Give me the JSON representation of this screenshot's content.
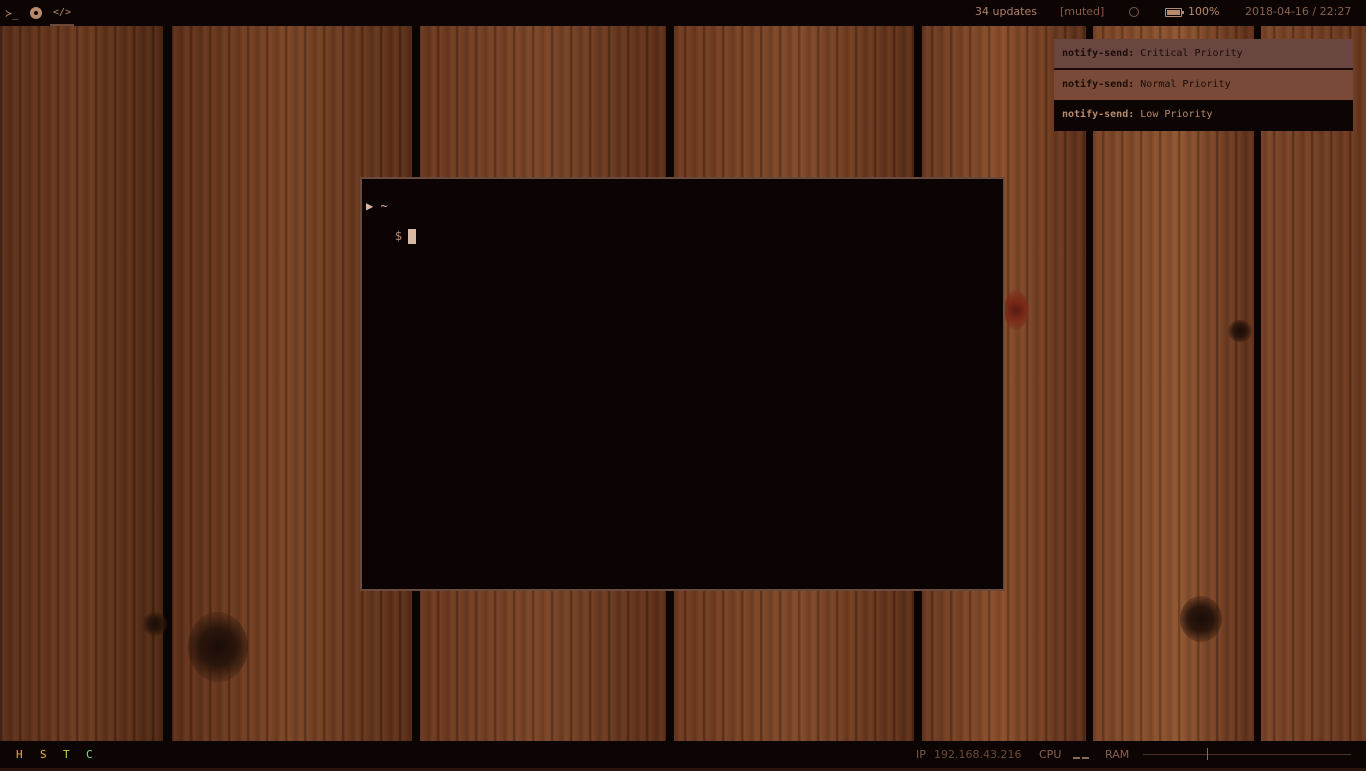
{
  "colors": {
    "bar_bg": "#0d0504",
    "accent": "#b88a6c",
    "terminal_bg": "#0c0404",
    "terminal_border": "#6a4a3a",
    "notif_critical_bg": "#6a4640",
    "notif_normal_bg": "#7a4a38",
    "notif_low_bg": "#0d0504",
    "tag_H": "#f2a33a",
    "tag_S": "#e8b545",
    "tag_T": "#b8d44a",
    "tag_C": "#7fe07a"
  },
  "topbar": {
    "workspaces": [
      {
        "icon": "terminal-icon",
        "glyph": "≻_"
      },
      {
        "icon": "chrome-icon",
        "glyph": ""
      },
      {
        "icon": "code-icon",
        "glyph": "</>"
      }
    ],
    "updates": "34 updates",
    "volume": "[muted]",
    "battery": "100%",
    "datetime": "2018-04-16 / 22:27"
  },
  "notifications": [
    {
      "app": "notify-send:",
      "message": "Critical Priority",
      "level": "critical"
    },
    {
      "app": "notify-send:",
      "message": "Normal Priority",
      "level": "normal"
    },
    {
      "app": "notify-send:",
      "message": "Low Priority",
      "level": "low"
    }
  ],
  "terminal": {
    "prompt_dir": "▶ ~",
    "prompt_symbol": "$"
  },
  "bottombar": {
    "tags": [
      "H",
      "S",
      "T",
      "C"
    ],
    "ip_label": "IP",
    "ip": "192.168.43.216",
    "cpu_label": "CPU",
    "ram_label": "RAM"
  }
}
